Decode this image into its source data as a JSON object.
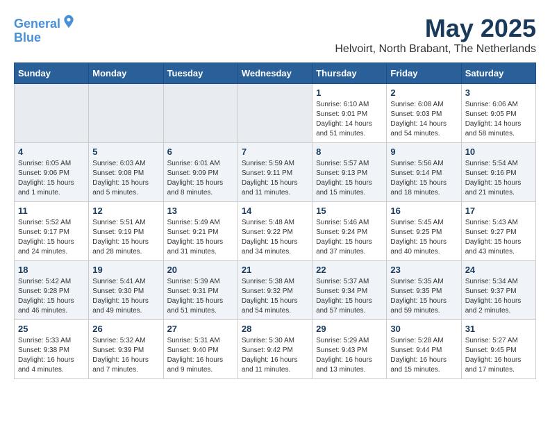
{
  "header": {
    "logo_line1": "General",
    "logo_line2": "Blue",
    "month": "May 2025",
    "location": "Helvoirt, North Brabant, The Netherlands"
  },
  "days_of_week": [
    "Sunday",
    "Monday",
    "Tuesday",
    "Wednesday",
    "Thursday",
    "Friday",
    "Saturday"
  ],
  "weeks": [
    [
      {
        "day": "",
        "info": ""
      },
      {
        "day": "",
        "info": ""
      },
      {
        "day": "",
        "info": ""
      },
      {
        "day": "",
        "info": ""
      },
      {
        "day": "1",
        "info": "Sunrise: 6:10 AM\nSunset: 9:01 PM\nDaylight: 14 hours\nand 51 minutes."
      },
      {
        "day": "2",
        "info": "Sunrise: 6:08 AM\nSunset: 9:03 PM\nDaylight: 14 hours\nand 54 minutes."
      },
      {
        "day": "3",
        "info": "Sunrise: 6:06 AM\nSunset: 9:05 PM\nDaylight: 14 hours\nand 58 minutes."
      }
    ],
    [
      {
        "day": "4",
        "info": "Sunrise: 6:05 AM\nSunset: 9:06 PM\nDaylight: 15 hours\nand 1 minute."
      },
      {
        "day": "5",
        "info": "Sunrise: 6:03 AM\nSunset: 9:08 PM\nDaylight: 15 hours\nand 5 minutes."
      },
      {
        "day": "6",
        "info": "Sunrise: 6:01 AM\nSunset: 9:09 PM\nDaylight: 15 hours\nand 8 minutes."
      },
      {
        "day": "7",
        "info": "Sunrise: 5:59 AM\nSunset: 9:11 PM\nDaylight: 15 hours\nand 11 minutes."
      },
      {
        "day": "8",
        "info": "Sunrise: 5:57 AM\nSunset: 9:13 PM\nDaylight: 15 hours\nand 15 minutes."
      },
      {
        "day": "9",
        "info": "Sunrise: 5:56 AM\nSunset: 9:14 PM\nDaylight: 15 hours\nand 18 minutes."
      },
      {
        "day": "10",
        "info": "Sunrise: 5:54 AM\nSunset: 9:16 PM\nDaylight: 15 hours\nand 21 minutes."
      }
    ],
    [
      {
        "day": "11",
        "info": "Sunrise: 5:52 AM\nSunset: 9:17 PM\nDaylight: 15 hours\nand 24 minutes."
      },
      {
        "day": "12",
        "info": "Sunrise: 5:51 AM\nSunset: 9:19 PM\nDaylight: 15 hours\nand 28 minutes."
      },
      {
        "day": "13",
        "info": "Sunrise: 5:49 AM\nSunset: 9:21 PM\nDaylight: 15 hours\nand 31 minutes."
      },
      {
        "day": "14",
        "info": "Sunrise: 5:48 AM\nSunset: 9:22 PM\nDaylight: 15 hours\nand 34 minutes."
      },
      {
        "day": "15",
        "info": "Sunrise: 5:46 AM\nSunset: 9:24 PM\nDaylight: 15 hours\nand 37 minutes."
      },
      {
        "day": "16",
        "info": "Sunrise: 5:45 AM\nSunset: 9:25 PM\nDaylight: 15 hours\nand 40 minutes."
      },
      {
        "day": "17",
        "info": "Sunrise: 5:43 AM\nSunset: 9:27 PM\nDaylight: 15 hours\nand 43 minutes."
      }
    ],
    [
      {
        "day": "18",
        "info": "Sunrise: 5:42 AM\nSunset: 9:28 PM\nDaylight: 15 hours\nand 46 minutes."
      },
      {
        "day": "19",
        "info": "Sunrise: 5:41 AM\nSunset: 9:30 PM\nDaylight: 15 hours\nand 49 minutes."
      },
      {
        "day": "20",
        "info": "Sunrise: 5:39 AM\nSunset: 9:31 PM\nDaylight: 15 hours\nand 51 minutes."
      },
      {
        "day": "21",
        "info": "Sunrise: 5:38 AM\nSunset: 9:32 PM\nDaylight: 15 hours\nand 54 minutes."
      },
      {
        "day": "22",
        "info": "Sunrise: 5:37 AM\nSunset: 9:34 PM\nDaylight: 15 hours\nand 57 minutes."
      },
      {
        "day": "23",
        "info": "Sunrise: 5:35 AM\nSunset: 9:35 PM\nDaylight: 15 hours\nand 59 minutes."
      },
      {
        "day": "24",
        "info": "Sunrise: 5:34 AM\nSunset: 9:37 PM\nDaylight: 16 hours\nand 2 minutes."
      }
    ],
    [
      {
        "day": "25",
        "info": "Sunrise: 5:33 AM\nSunset: 9:38 PM\nDaylight: 16 hours\nand 4 minutes."
      },
      {
        "day": "26",
        "info": "Sunrise: 5:32 AM\nSunset: 9:39 PM\nDaylight: 16 hours\nand 7 minutes."
      },
      {
        "day": "27",
        "info": "Sunrise: 5:31 AM\nSunset: 9:40 PM\nDaylight: 16 hours\nand 9 minutes."
      },
      {
        "day": "28",
        "info": "Sunrise: 5:30 AM\nSunset: 9:42 PM\nDaylight: 16 hours\nand 11 minutes."
      },
      {
        "day": "29",
        "info": "Sunrise: 5:29 AM\nSunset: 9:43 PM\nDaylight: 16 hours\nand 13 minutes."
      },
      {
        "day": "30",
        "info": "Sunrise: 5:28 AM\nSunset: 9:44 PM\nDaylight: 16 hours\nand 15 minutes."
      },
      {
        "day": "31",
        "info": "Sunrise: 5:27 AM\nSunset: 9:45 PM\nDaylight: 16 hours\nand 17 minutes."
      }
    ]
  ]
}
